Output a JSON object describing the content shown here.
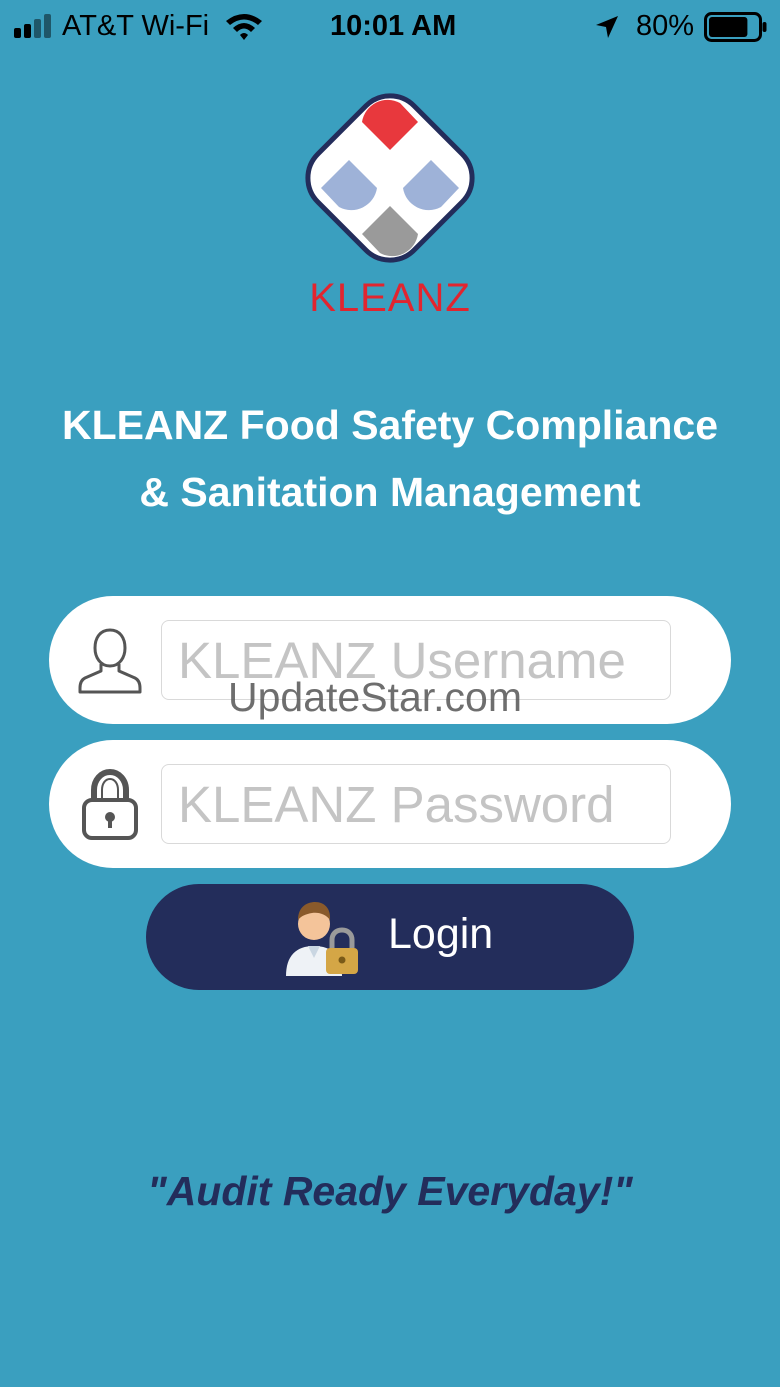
{
  "colors": {
    "background": "#3a9fbf",
    "accent_navy": "#232d5b",
    "brand_red": "#e1252f",
    "field_background": "#ffffff"
  },
  "status_bar": {
    "carrier": "AT&T Wi-Fi",
    "time": "10:01 AM",
    "battery_percent": "80%",
    "battery_level": 0.8,
    "signal_bars_active": 2,
    "signal_bars_total": 4,
    "icons": [
      "signal-icon",
      "wifi-icon",
      "location-arrow-icon",
      "battery-icon"
    ]
  },
  "logo": {
    "wordmark": "KLEANZ"
  },
  "headline": {
    "line1": "KLEANZ Food Safety Compliance",
    "line2": "& Sanitation Management"
  },
  "login_form": {
    "username": {
      "placeholder": "KLEANZ Username",
      "value": "",
      "icon": "user-icon"
    },
    "password": {
      "placeholder": "KLEANZ Password",
      "value": "",
      "icon": "lock-icon"
    },
    "login_button": {
      "label": "Login",
      "icon": "user-lock-icon"
    }
  },
  "watermark": "UpdateStar.com",
  "tagline": "\"Audit Ready Everyday!\""
}
